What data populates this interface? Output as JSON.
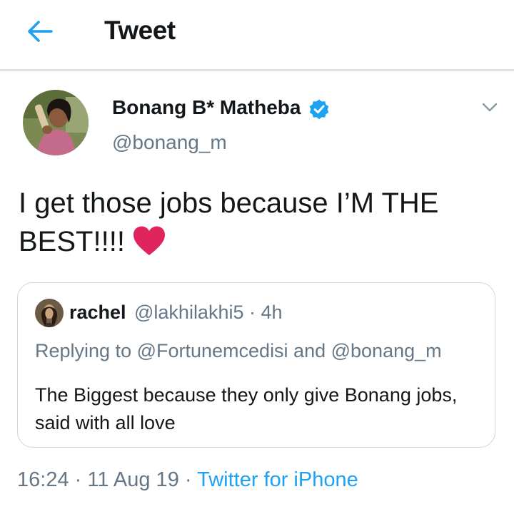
{
  "header": {
    "title": "Tweet",
    "back_icon": "arrow-left-icon"
  },
  "colors": {
    "accent": "#1da1f2",
    "secondary_text": "#657786",
    "heart": "#e0245e"
  },
  "tweet": {
    "author_name": "Bonang B* Matheba",
    "handle": "@bonang_m",
    "verified": true,
    "text": "I get those jobs because I’M THE BEST!!!!",
    "emoji": "heart-icon"
  },
  "quote": {
    "name": "rachel",
    "handle_time": "@lakhilakhi5 · 4h",
    "replying": "Replying to @Fortunemcedisi and @bonang_m",
    "text": "The Biggest because they only give Bonang jobs, said with all love"
  },
  "meta": {
    "datetime": "16:24 · 11 Aug 19 · ",
    "source": "Twitter for iPhone"
  }
}
